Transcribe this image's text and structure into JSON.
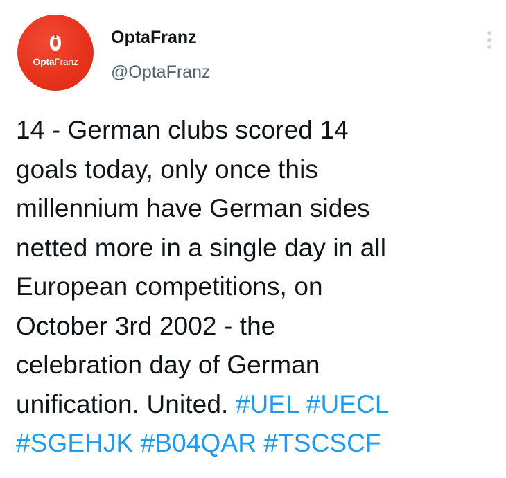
{
  "author": {
    "display_name": "OptaFranz",
    "handle": "@OptaFranz",
    "avatar": {
      "brand": "Opta",
      "sub": "Franz",
      "color": "#e8331c"
    }
  },
  "menu": {
    "icon": "more-vertical-icon"
  },
  "tweet": {
    "lines": [
      "14 - German clubs scored 14",
      "goals today, only once this",
      "millennium have German sides",
      "netted more in a single day in all",
      "European competitions, on",
      "October 3rd 2002 - the",
      "celebration day of German",
      "unification. United."
    ],
    "hashtags": [
      "#UEL",
      "#UECL",
      "#SGEHJK",
      "#B04QAR",
      "#TSCSCF"
    ],
    "hashtag_color": "#1d9bf0"
  }
}
